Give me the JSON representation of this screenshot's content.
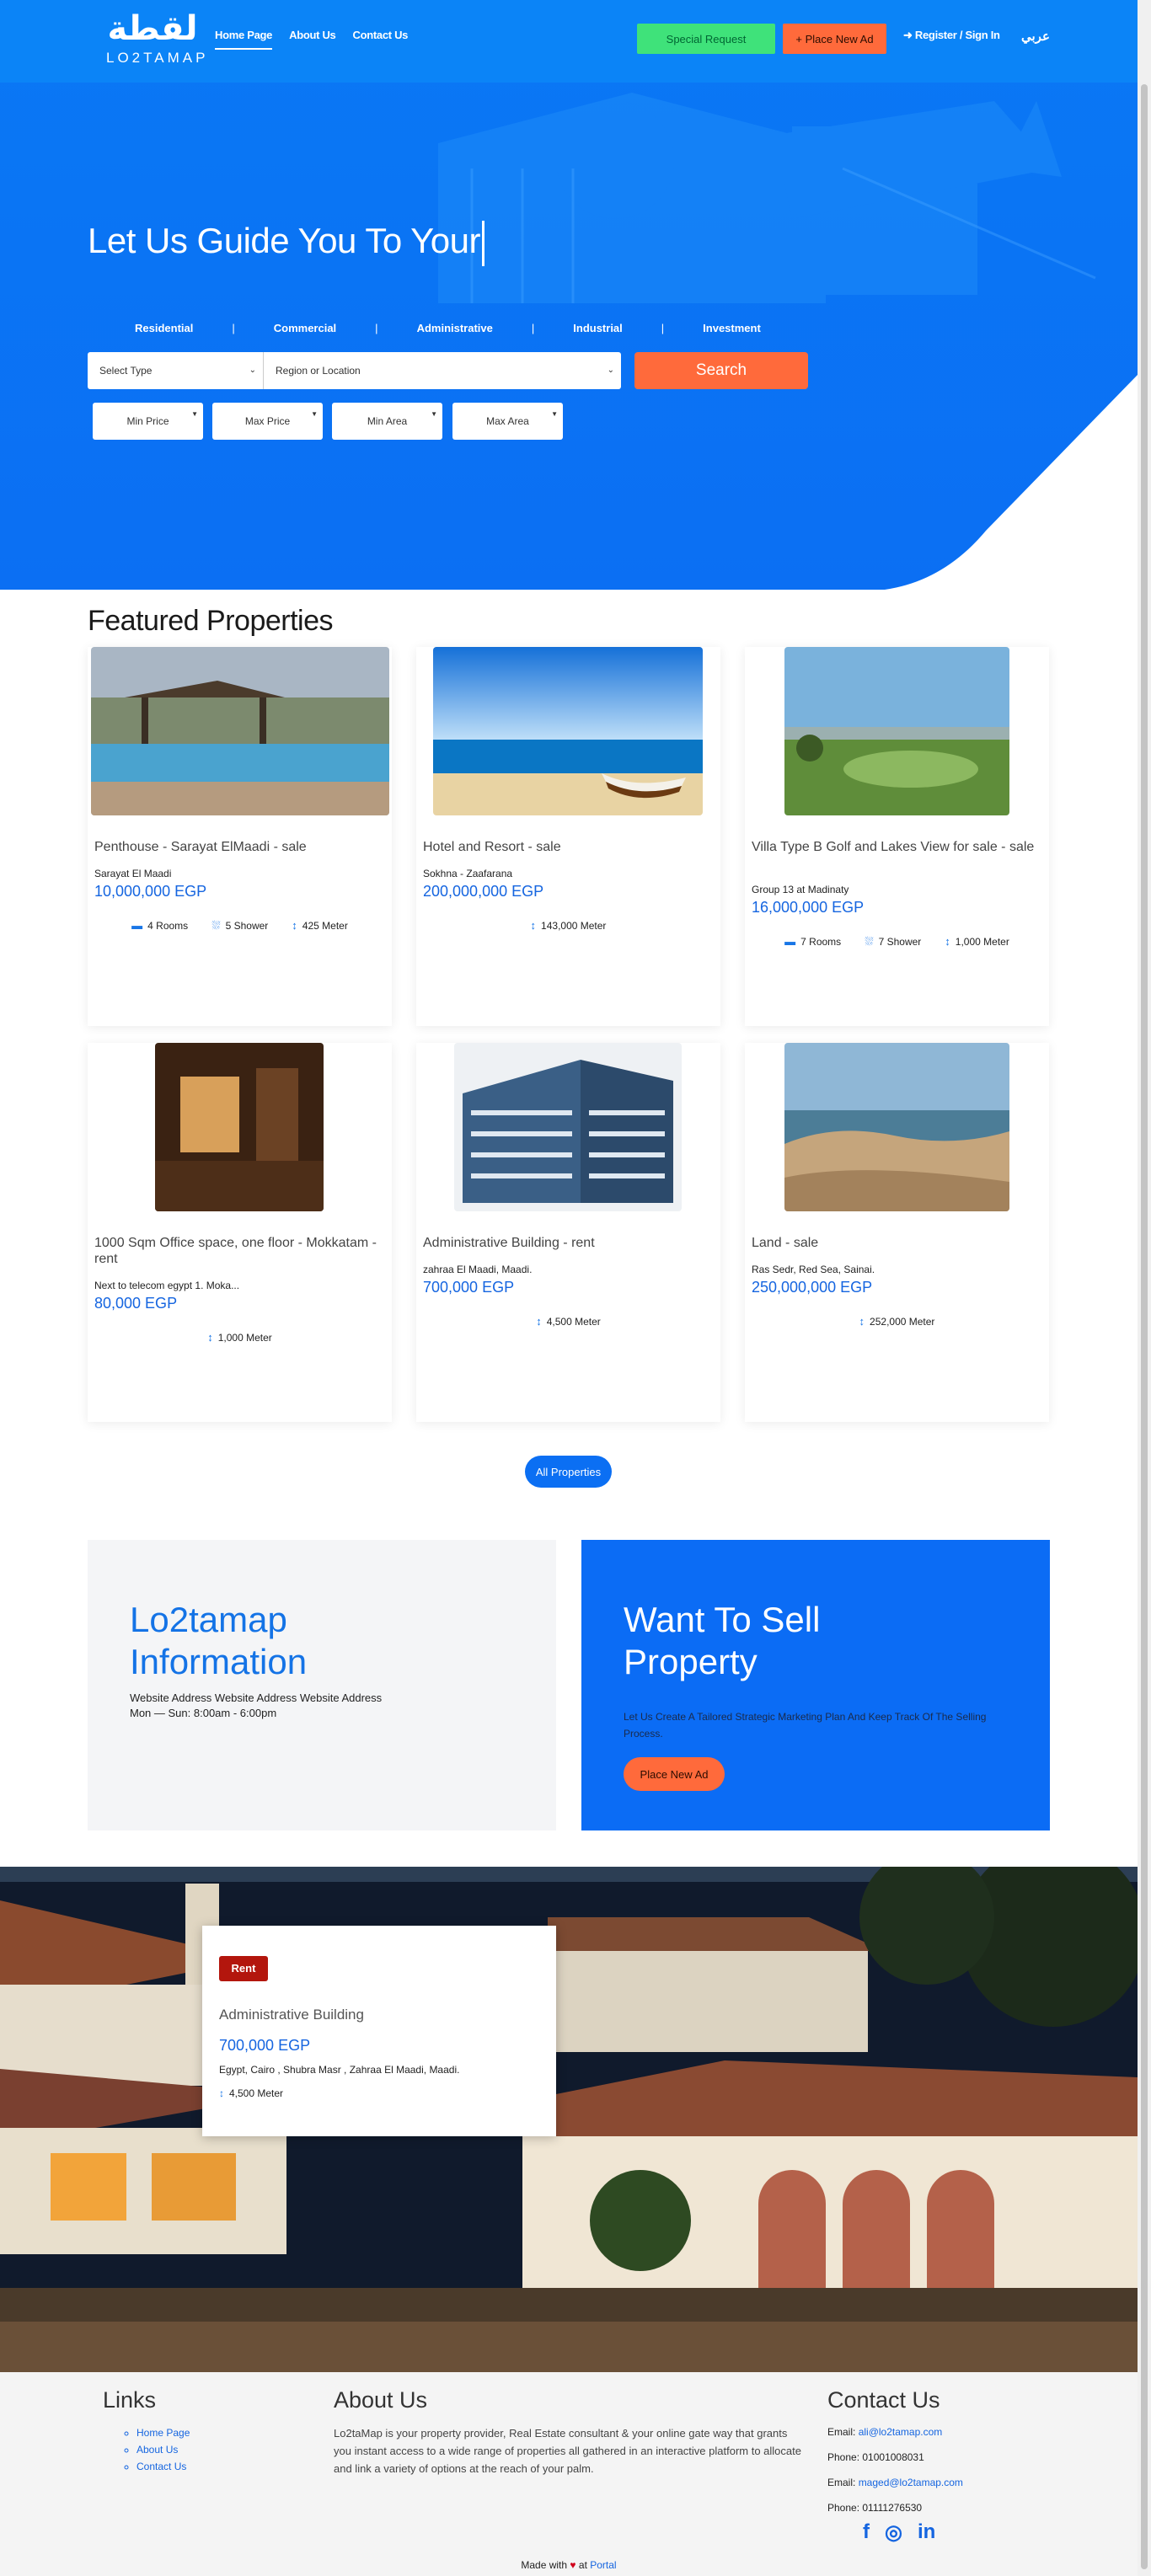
{
  "header": {
    "logo_mark": "لقطة",
    "logo_word": "LO2TAMAP",
    "nav": [
      "Home Page",
      "About Us",
      "Contact Us"
    ],
    "special_request": "Special Request",
    "place_new_ad": "+ Place New Ad",
    "register": "Register / Sign In",
    "language": "عربي"
  },
  "hero": {
    "title": "Let Us Guide You To Your",
    "categories": [
      "Residential",
      "Commercial",
      "Administrative",
      "Industrial",
      "Investment"
    ],
    "select_type": "Select Type",
    "region": "Region or Location",
    "search": "Search",
    "min_price": "Min Price",
    "max_price": "Max Price",
    "min_area": "Min Area",
    "max_area": "Max Area"
  },
  "featured": {
    "title": "Featured Properties",
    "cards": [
      {
        "title": "Penthouse - Sarayat ElMaadi - sale",
        "address": "Sarayat El Maadi",
        "price": "10,000,000 EGP",
        "rooms": "4 Rooms",
        "shower": "5 Shower",
        "area": "425 Meter"
      },
      {
        "title": "Hotel and Resort - sale",
        "address": "Sokhna - Zaafarana",
        "price": "200,000,000 EGP",
        "area": "143,000 Meter"
      },
      {
        "title": "Villa Type B Golf and Lakes View for sale - sale",
        "address": "Group 13 at Madinaty",
        "price": "16,000,000 EGP",
        "rooms": "7 Rooms",
        "shower": "7 Shower",
        "area": "1,000 Meter"
      },
      {
        "title": "1000 Sqm Office space, one floor - Mokkatam - rent",
        "address": "Next to telecom egypt 1. Moka...",
        "price": "80,000 EGP",
        "area": "1,000 Meter"
      },
      {
        "title": "Administrative Building - rent",
        "address": "zahraa El Maadi, Maadi.",
        "price": "700,000 EGP",
        "area": "4,500 Meter"
      },
      {
        "title": "Land - sale",
        "address": "Ras Sedr, Red Sea, Sainai.",
        "price": "250,000,000 EGP",
        "area": "252,000 Meter"
      }
    ],
    "all_button": "All Properties"
  },
  "info": {
    "title": "Lo2tamap Information",
    "address": "Website Address Website Address Website Address",
    "hours": "Mon — Sun: 8:00am - 6:00pm"
  },
  "sell": {
    "title": "Want To Sell Property",
    "text": "Let Us Create A Tailored Strategic Marketing Plan And Keep Track Of The Selling Process.",
    "button": "Place New Ad"
  },
  "rent_banner": {
    "badge": "Rent",
    "title": "Administrative Building",
    "price": "700,000 EGP",
    "address": "Egypt, Cairo , Shubra Masr , Zahraa El Maadi, Maadi.",
    "area": "4,500 Meter"
  },
  "footer": {
    "links_title": "Links",
    "links": [
      "Home Page",
      "About Us",
      "Contact Us"
    ],
    "about_title": "About Us",
    "about_text": "Lo2taMap is your property provider, Real Estate consultant & your online gate way that grants you instant access to a wide range of properties all gathered in an interactive platform to allocate and link a variety of options at the reach of your palm.",
    "contact_title": "Contact Us",
    "email1_label": "Email:",
    "email1": "ali@lo2tamap.com",
    "phone1": "Phone: 01001008031",
    "email2_label": "Email:",
    "email2": "maged@lo2tamap.com",
    "phone2": "Phone: 01111276530",
    "social": [
      "f",
      "◎",
      "in"
    ],
    "made_prefix": "Made with",
    "made_mid": "at",
    "made_link": "Portal"
  },
  "colors": {
    "primary": "#0b6ff3",
    "accent": "#ff6a3b",
    "green": "#3fe27a",
    "rent": "#b3160d"
  }
}
